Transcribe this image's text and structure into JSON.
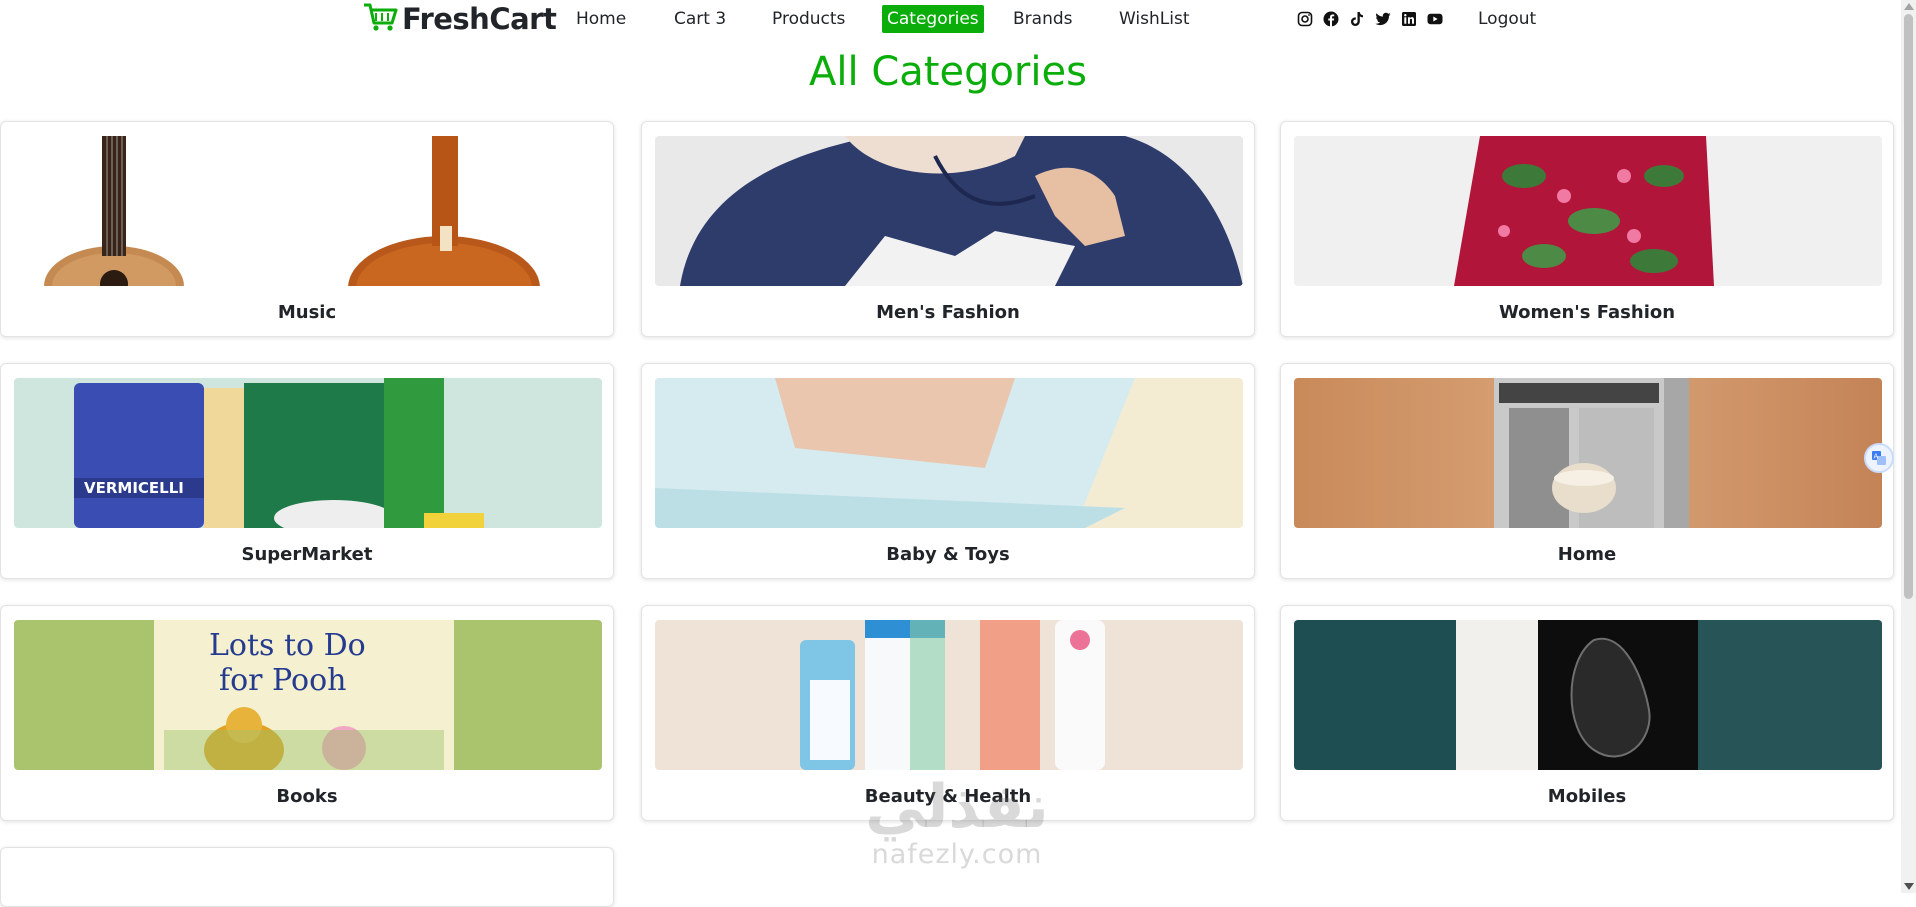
{
  "brand": {
    "name": "FreshCart",
    "icon": "cart-icon",
    "color": "#0aad0a"
  },
  "nav": {
    "home": "Home",
    "cart": "Cart 3",
    "products": "Products",
    "categories": "Categories",
    "brands": "Brands",
    "wishlist": "WishList",
    "logout": "Logout",
    "active": "Categories"
  },
  "social_icons": [
    "instagram-icon",
    "facebook-icon",
    "tiktok-icon",
    "twitter-icon",
    "linkedin-icon",
    "youtube-icon"
  ],
  "page": {
    "title": "All Categories"
  },
  "categories": [
    {
      "name": "Music"
    },
    {
      "name": "Men's Fashion"
    },
    {
      "name": "Women's Fashion"
    },
    {
      "name": "SuperMarket"
    },
    {
      "name": "Baby & Toys"
    },
    {
      "name": "Home"
    },
    {
      "name": "Books"
    },
    {
      "name": "Beauty & Health"
    },
    {
      "name": "Mobiles"
    }
  ],
  "book_cover": {
    "title_line1": "Lots to Do",
    "title_line2": "for Pooh"
  },
  "supermarket_label": "VERMICELLI",
  "watermark": {
    "arabic": "نفذلي",
    "site": "nafezly.com"
  },
  "colors": {
    "accent": "#0aad0a",
    "text": "#212529",
    "card_border": "#e3e3e3"
  }
}
